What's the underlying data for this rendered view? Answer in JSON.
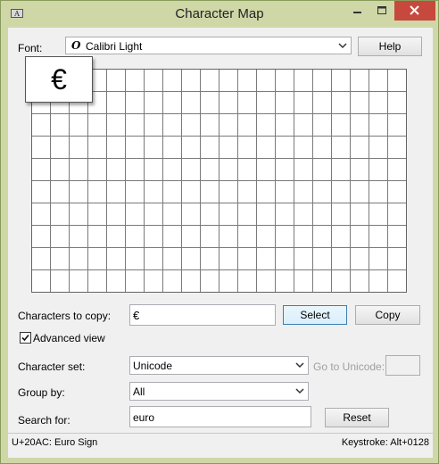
{
  "window": {
    "title": "Character Map"
  },
  "font": {
    "label": "Font:",
    "icon": "opentype-font-icon",
    "icon_glyph": "O",
    "selected": "Calibri Light"
  },
  "help_label": "Help",
  "grid": {
    "zoom_char": "€"
  },
  "copy": {
    "label": "Characters to copy:",
    "value": "€",
    "select_label": "Select",
    "copy_label": "Copy"
  },
  "advanced_view": {
    "label": "Advanced view",
    "checked": true
  },
  "character_set": {
    "label": "Character set:",
    "selected": "Unicode"
  },
  "goto_unicode": {
    "label": "Go to Unicode:",
    "value": ""
  },
  "group_by": {
    "label": "Group by:",
    "selected": "All"
  },
  "search": {
    "label": "Search for:",
    "value": "euro",
    "reset_label": "Reset"
  },
  "status": {
    "character": "U+20AC: Euro Sign",
    "keystroke": "Keystroke: Alt+0128"
  }
}
